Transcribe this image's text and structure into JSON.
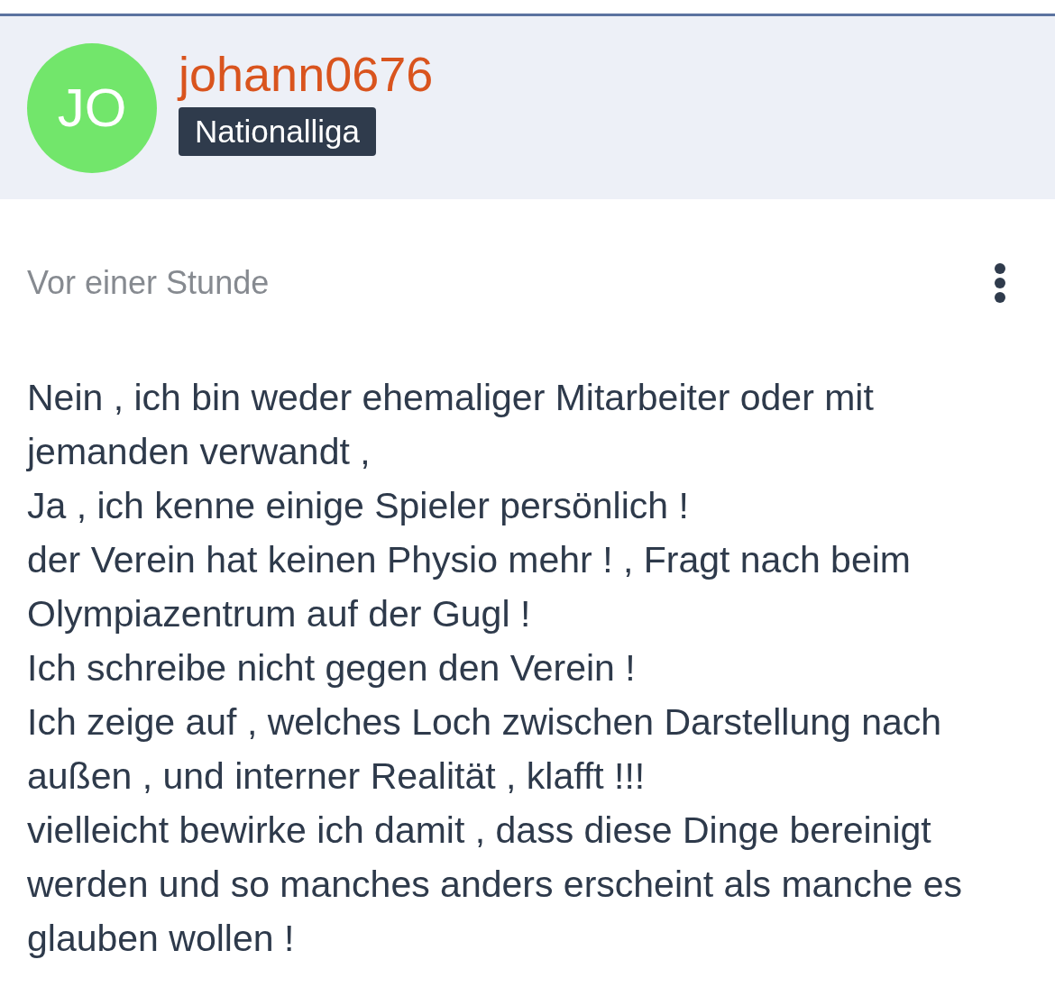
{
  "author": {
    "initials": "JO",
    "username": "johann0676",
    "rank": "Nationalliga"
  },
  "post": {
    "time": "Vor einer Stunde",
    "lines": [
      "Nein , ich bin weder ehemaliger Mitarbeiter oder mit jemanden verwandt ,",
      "Ja , ich kenne einige Spieler persönlich !",
      "der Verein hat keinen Physio mehr ! , Fragt nach beim Olympiazentrum auf der Gugl !",
      "Ich schreibe nicht gegen den Verein !",
      "Ich zeige auf , welches Loch zwischen Darstellung nach außen , und interner Realität , klafft !!!",
      "vielleicht bewirke ich damit , dass diese Dinge bereinigt werden und so manches anders erscheint als manche es glauben wollen !"
    ]
  }
}
